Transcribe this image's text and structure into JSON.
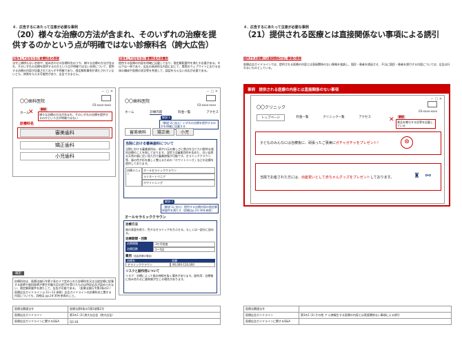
{
  "left": {
    "section_head": "４．広告するにあたって注意が必要な事例",
    "title_line1": "（20）様々な治療の方法が含まれ、そのいずれの治療を提",
    "title_line2": "供するのかという点が明確ではない診療科名（誇大広告）",
    "bad_label": "広告をしてはならない診療科名の表現",
    "bad_text": "法令上標榜もない名称や、組み合わせの診療科名のうち、様々な治療の方法が含まれ、そのいずれの治療を提供するのかという点が明確ではない名称について、提供する治療の内容が記載されておらず不明確であり、限定解釈事例が満たされていないとも、誇張を与える可能性があり、広告できません。",
    "good_label": "広告をしてはならない診療科名の改善例",
    "good_text": "提供する医療の内容を明確に記載しており、限定解釈要件を満たす必要がある。※以下は一例であり、広告の具体的な内容に応じて、実際のウェブサイトにおける全体の構成や医療の状況等を考慮して、誤認を与えない対応が必要である。",
    "mock1": {
      "clinic": "〇〇歯科医院",
      "phone": "03-xxxx-xxxx",
      "home": "ホーム",
      "kaisetsu": "解説",
      "kaisetsu_text": "様々な治療の方法が含まれ、そのいずれの治療を提供するのかという点が明確ではない",
      "menu_label": "診療科名",
      "btn1": "審美歯科",
      "btn2": "矯正歯科",
      "btn3": "小児歯科"
    },
    "mock2": {
      "clinic": "〇〇歯科医院",
      "phone": "03-xxxx-xxxx",
      "nav": [
        "ホーム",
        "診療内容",
        "料金一覧",
        "アクセス"
      ],
      "kaisetsu1": "解説-1",
      "kaisetsu1_text": "（解説-2に加え）いずれの治療を提供するのかを明確に記載する",
      "tabs": [
        "審美歯科",
        "矯正歯",
        "小児"
      ],
      "heading": "当院における審美歯科について",
      "body": "当院における審美歯科は、歯や口元の美しさに焦点を当てた口腔的な歯科治療のことを指しております。当院では審美目的を含めた、白い自然な天然の歯に近い見た目で審美修復が可能です。セラミッククラウン等、歯の色や形を美しく整えるための「ホワイトニング」などの治療を提供しております。",
      "menu_label": "治療メニュー",
      "menu_items": [
        "オールセラミッククラウン",
        "ラミネートベニア",
        "ホワイトニング"
      ],
      "kaisetsu2": "解説-2",
      "kaisetsu2_text": "（解説-1に加え）提供する治療内容の限定解釈要件を満たす（詳細はp.24-30を参照）",
      "sub_heading": "オールセラミッククラウン",
      "method_label": "治療方法",
      "method_text": "歯の表面を削り、色々なセラミックをかぶせる。もしくは一部分に詰める。",
      "period_label": "治療期間・回数",
      "period_rows": [
        [
          "治療期間",
          "3か月程度"
        ],
        [
          "治療回数",
          "2～5回"
        ]
      ],
      "fee_label": "費用",
      "fee_note": "（自由診療の場合）",
      "fee_head": [
        "治療名",
        "金額"
      ],
      "fee_row": [
        "セラミッククラウン",
        "90,000-120,000"
      ],
      "risk_label": "リスクと副作用について",
      "risk_text": "リスク：治療によって歯の神経を抜く場合があります。副作用：治療後に咬み合わせに違和感が生じる場合があります。"
    },
    "supplement_label": "補足",
    "supplement_text": "診療科名は、医療法施行令第３条の２で定められた診療科名又は当該診療に従事する医師や歯科医師が厚生労働大臣の許可を受けたものは特定広告が認められない、限定解釈要件を満たして、広告が可能である。（医療法施行令第3条の2 / 医療広告ガイドライン p.11～12 参照）広告ガイドラインの診療科名に関する内容についても、詳細は pp.24-30を参照のこと。",
    "meta": [
      [
        "医療法関連法令",
        "医療法第6条の5第2項第2号"
      ],
      [
        "医療広告ガイドライン",
        "第3の1 (3) 誇大な広告（誇大広告）"
      ],
      [
        "医療広告ガイドラインに関するQ&A",
        "Q3-18"
      ]
    ]
  },
  "right": {
    "section_head": "４．広告するにあたって注意が必要な事例",
    "title": "（21）提供される医療とは直接関係ない事項による誘引",
    "bad_label": "提供される医療とは直接関係のない事項の表現",
    "bad_text": "医療広告ガイドラインでは、提供される医療の内容とは直接関係のない情報を強調し、国民・患者を誘因させ、不当に国民・患者を誘引する内容については、広告は行わないものとしている。",
    "example_banner": "事例　提供される医療の内容とは直接関係のない事項",
    "clinic": "〇〇クリニック",
    "phone": "03-xxxx-xxxx",
    "nav": [
      "トップページ",
      "料金一覧",
      "クリニック一覧",
      "アクセス"
    ],
    "kaisetsu": "解説",
    "kaisetsu_text": "景品を贈与する旨等を記載している",
    "promo1_text": "子どものみんなには治療後に、頑張ったご褒美に",
    "promo1_red": "ガチャガチャをプレゼント！",
    "promo2_text": "当院でお産された方には、",
    "promo2_red": "出産祝いとして赤ちゃんグッズをプレゼント",
    "promo2_tail": "しております。",
    "meta": [
      [
        "医療法関連法令",
        ""
      ],
      [
        "医療広告ガイドライン",
        "第3の1 (3) その他 ア 公衆衛生する医療の内容とは直接関係ない事項による誘引"
      ],
      [
        "医療広告ガイドラインに関するQ&A",
        ""
      ]
    ]
  },
  "colors": {
    "accent_red": "#cc0000",
    "navy": "#1f3a7a"
  }
}
